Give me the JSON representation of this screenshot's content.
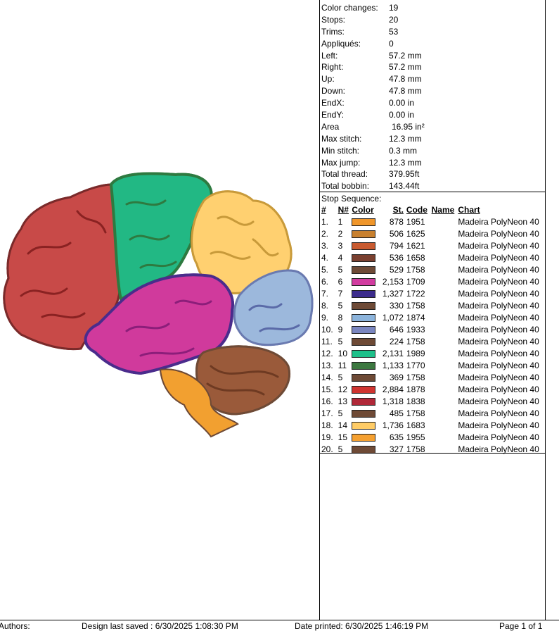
{
  "stats": [
    {
      "label": "Color changes:",
      "value": "19"
    },
    {
      "label": "Stops:",
      "value": "20"
    },
    {
      "label": "Trims:",
      "value": "53"
    },
    {
      "label": "Appliqués:",
      "value": "0"
    },
    {
      "label": "Left:",
      "value": "57.2 mm"
    },
    {
      "label": "Right:",
      "value": "57.2 mm"
    },
    {
      "label": "Up:",
      "value": "47.8 mm"
    },
    {
      "label": "Down:",
      "value": "47.8 mm"
    },
    {
      "label": "EndX:",
      "value": "0.00 in"
    },
    {
      "label": "EndY:",
      "value": "0.00 in"
    },
    {
      "label": "Area",
      "value": "16.95 in²"
    },
    {
      "label": "Max stitch:",
      "value": "12.3 mm"
    },
    {
      "label": "Min stitch:",
      "value": "0.3 mm"
    },
    {
      "label": "Max jump:",
      "value": "12.3 mm"
    },
    {
      "label": "Total thread:",
      "value": "379.95ft"
    },
    {
      "label": "Total bobbin:",
      "value": "143.44ft"
    }
  ],
  "sequence": {
    "title": "Stop Sequence:",
    "headers": {
      "idx": "#",
      "n": "N#",
      "color": "Color",
      "st": "St.",
      "code": "Code",
      "name": "Name",
      "chart": "Chart"
    },
    "rows": [
      {
        "idx": "1.",
        "n": "1",
        "color": "#f0962a",
        "st": "878",
        "code": "1951",
        "name": "",
        "chart": "Madeira PolyNeon 40"
      },
      {
        "idx": "2.",
        "n": "2",
        "color": "#c8802e",
        "st": "506",
        "code": "1625",
        "name": "",
        "chart": "Madeira PolyNeon 40"
      },
      {
        "idx": "3.",
        "n": "3",
        "color": "#c85a30",
        "st": "794",
        "code": "1621",
        "name": "",
        "chart": "Madeira PolyNeon 40"
      },
      {
        "idx": "4.",
        "n": "4",
        "color": "#7a4030",
        "st": "536",
        "code": "1658",
        "name": "",
        "chart": "Madeira PolyNeon 40"
      },
      {
        "idx": "5.",
        "n": "5",
        "color": "#6e4a36",
        "st": "529",
        "code": "1758",
        "name": "",
        "chart": "Madeira PolyNeon 40"
      },
      {
        "idx": "6.",
        "n": "6",
        "color": "#d23ca0",
        "st": "2,153",
        "code": "1709",
        "name": "",
        "chart": "Madeira PolyNeon 40"
      },
      {
        "idx": "7.",
        "n": "7",
        "color": "#3c2c8c",
        "st": "1,327",
        "code": "1722",
        "name": "",
        "chart": "Madeira PolyNeon 40"
      },
      {
        "idx": "8.",
        "n": "5",
        "color": "#6e4a36",
        "st": "330",
        "code": "1758",
        "name": "",
        "chart": "Madeira PolyNeon 40"
      },
      {
        "idx": "9.",
        "n": "8",
        "color": "#8cb4dc",
        "st": "1,072",
        "code": "1874",
        "name": "",
        "chart": "Madeira PolyNeon 40"
      },
      {
        "idx": "10.",
        "n": "9",
        "color": "#7a86c0",
        "st": "646",
        "code": "1933",
        "name": "",
        "chart": "Madeira PolyNeon 40"
      },
      {
        "idx": "11.",
        "n": "5",
        "color": "#6e4a36",
        "st": "224",
        "code": "1758",
        "name": "",
        "chart": "Madeira PolyNeon 40"
      },
      {
        "idx": "12.",
        "n": "10",
        "color": "#1ec08a",
        "st": "2,131",
        "code": "1989",
        "name": "",
        "chart": "Madeira PolyNeon 40"
      },
      {
        "idx": "13.",
        "n": "11",
        "color": "#3c7840",
        "st": "1,133",
        "code": "1770",
        "name": "",
        "chart": "Madeira PolyNeon 40"
      },
      {
        "idx": "14.",
        "n": "5",
        "color": "#6e4a36",
        "st": "369",
        "code": "1758",
        "name": "",
        "chart": "Madeira PolyNeon 40"
      },
      {
        "idx": "15.",
        "n": "12",
        "color": "#d03430",
        "st": "2,884",
        "code": "1878",
        "name": "",
        "chart": "Madeira PolyNeon 40"
      },
      {
        "idx": "16.",
        "n": "13",
        "color": "#b02838",
        "st": "1,318",
        "code": "1838",
        "name": "",
        "chart": "Madeira PolyNeon 40"
      },
      {
        "idx": "17.",
        "n": "5",
        "color": "#6e4a36",
        "st": "485",
        "code": "1758",
        "name": "",
        "chart": "Madeira PolyNeon 40"
      },
      {
        "idx": "18.",
        "n": "14",
        "color": "#ffcc66",
        "st": "1,736",
        "code": "1683",
        "name": "",
        "chart": "Madeira PolyNeon 40"
      },
      {
        "idx": "19.",
        "n": "15",
        "color": "#f5a030",
        "st": "635",
        "code": "1955",
        "name": "",
        "chart": "Madeira PolyNeon 40"
      },
      {
        "idx": "20.",
        "n": "5",
        "color": "#6e4a36",
        "st": "327",
        "code": "1758",
        "name": "",
        "chart": "Madeira PolyNeon 40"
      }
    ]
  },
  "footer": {
    "authors": "Authors:",
    "saved": "Design last saved : 6/30/2025 1:08:30 PM",
    "printed": "Date printed: 6/30/2025 1:46:19 PM",
    "page": "Page 1 of 1"
  },
  "preview": {
    "frontal_color": "#c84a48",
    "parietal_color": "#22b884",
    "occipital_color": "#ffd070",
    "temporal_color": "#d03a9c",
    "visual_color": "#9cb8dc",
    "cerebellum_color": "#9a5a3a",
    "stem_color": "#f2a030",
    "outline_color": "#6e4a36"
  }
}
